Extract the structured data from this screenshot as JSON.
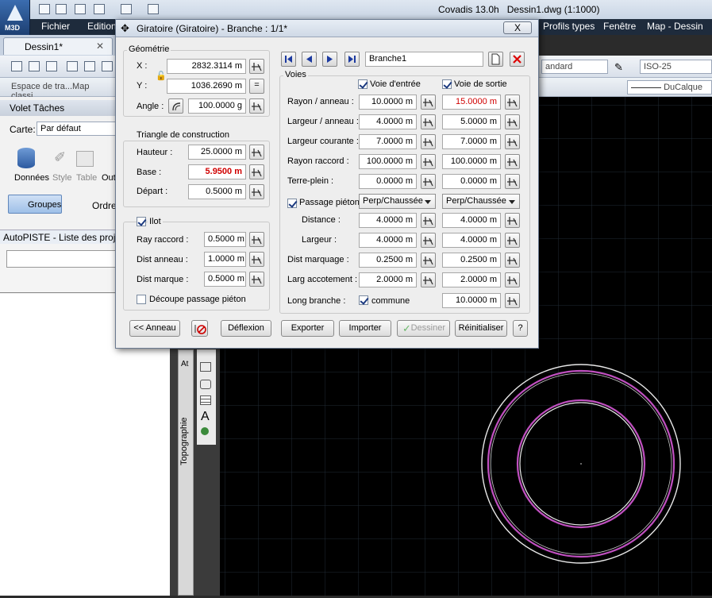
{
  "app": {
    "badge": "M3D",
    "title": "Covadis 13.0h",
    "file": "Dessin1.dwg (1:1000)"
  },
  "menu": [
    "Fichier",
    "Edition",
    "Profils types",
    "Fenêtre",
    "Map - Dessin"
  ],
  "doc_tab": "Dessin1*",
  "toolbar2": {
    "workspace": "Espace de tra...Map classi",
    "layer": "DuCalque",
    "style": "andard",
    "dimstyle": "ISO-25"
  },
  "task_pane": {
    "title": "Volet Tâches",
    "carte_label": "Carte:",
    "carte_value": "Par défaut",
    "buttons": [
      "Données",
      "Style",
      "Table",
      "Out"
    ],
    "groupes": "Groupes",
    "ordre": "Ordre"
  },
  "autopiste": {
    "title": "AutoPISTE - Liste des projet"
  },
  "side_tabs": {
    "topo": "Topographie",
    "at": "At"
  },
  "dialog": {
    "title": "Giratoire (Giratoire) - Branche : 1/1*",
    "close": "X",
    "geometrie": {
      "label": "Géométrie",
      "x_label": "X :",
      "x": "2832.3114 m",
      "y_label": "Y :",
      "y": "1036.2690 m",
      "equal_btn": "=",
      "angle_label": "Angle :",
      "angle": "100.0000 g"
    },
    "triangle": {
      "label": "Triangle de construction",
      "hauteur_label": "Hauteur :",
      "hauteur": "25.0000 m",
      "base_label": "Base :",
      "base": "5.9500 m",
      "depart_label": "Départ :",
      "depart": "0.5000 m"
    },
    "ilot": {
      "label": "Ilot",
      "checked": true,
      "ray_raccord_label": "Ray raccord :",
      "ray_raccord": "0.5000 m",
      "dist_anneau_label": "Dist anneau :",
      "dist_anneau": "1.0000 m",
      "dist_marque_label": "Dist marque :",
      "dist_marque": "0.5000 m",
      "decoupe_label": "Découpe passage piéton",
      "decoupe_checked": false
    },
    "branche_name": "Branche1",
    "voies": {
      "label": "Voies",
      "entree_label": "Voie d'entrée",
      "sortie_label": "Voie de sortie",
      "rows": [
        {
          "label": "Rayon / anneau :",
          "entree": "10.0000 m",
          "sortie": "15.0000 m"
        },
        {
          "label": "Largeur / anneau :",
          "entree": "4.0000 m",
          "sortie": "5.0000 m"
        },
        {
          "label": "Largeur courante :",
          "entree": "7.0000 m",
          "sortie": "7.0000 m"
        },
        {
          "label": "Rayon raccord :",
          "entree": "100.0000 m",
          "sortie": "100.0000 m"
        },
        {
          "label": "Terre-plein :",
          "entree": "0.0000 m",
          "sortie": "0.0000 m"
        }
      ],
      "passage_label": "Passage piéton",
      "passage_entree": "Perp/Chaussée",
      "passage_sortie": "Perp/Chaussée",
      "rows2": [
        {
          "label": "Distance :",
          "entree": "4.0000 m",
          "sortie": "4.0000 m"
        },
        {
          "label": "Largeur :",
          "entree": "4.0000 m",
          "sortie": "4.0000 m"
        },
        {
          "label": "Dist marquage :",
          "entree": "0.2500 m",
          "sortie": "0.2500 m"
        },
        {
          "label": "Larg accotement :",
          "entree": "2.0000 m",
          "sortie": "2.0000 m"
        }
      ],
      "long_branche_label": "Long branche :",
      "commune_label": "commune",
      "long_branche": "10.0000 m"
    },
    "buttons": {
      "anneau": "<< Anneau",
      "deflexion": "Déflexion",
      "exporter": "Exporter",
      "importer": "Importer",
      "dessiner": "Dessiner",
      "reinitialiser": "Réinitialiser",
      "help": "?"
    }
  },
  "colors": {
    "ring_outer": "#ffffff",
    "ring_magenta": "#c050c0",
    "canvas_bg": "#000000",
    "grid": "#1c2a36"
  }
}
